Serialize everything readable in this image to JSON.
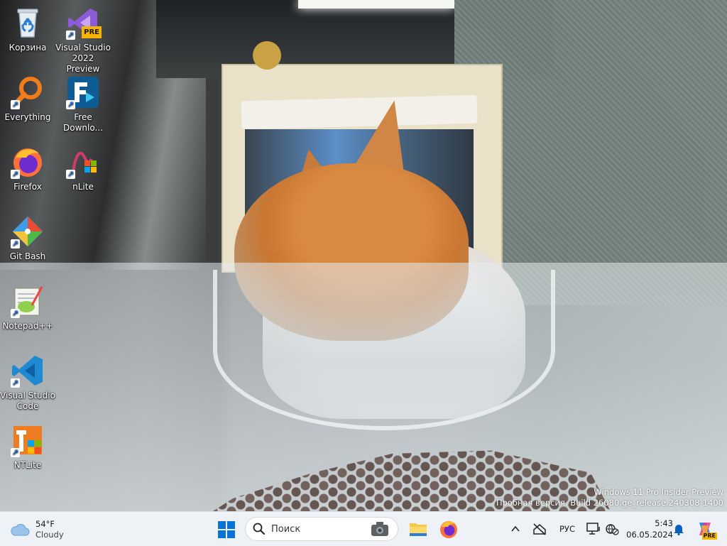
{
  "desktop": {
    "icons": [
      {
        "label": "Корзина"
      },
      {
        "label": "Visual Studio 2022 Preview",
        "badge": "PRE"
      },
      {
        "label": "Everything"
      },
      {
        "label": "Free Downlo..."
      },
      {
        "label": "Firefox"
      },
      {
        "label": "nLite"
      },
      {
        "label": "Git Bash"
      },
      {
        "label": "Notepad++"
      },
      {
        "label": "Visual Studio Code"
      },
      {
        "label": "NTLite"
      }
    ]
  },
  "watermark": {
    "line1": "Windows 11 Pro Insider Preview",
    "line2": "Пробная версия. Build 26080.ge_release.240308-1400"
  },
  "taskbar": {
    "weather": {
      "temp": "54°F",
      "condition": "Cloudy"
    },
    "search": {
      "placeholder": "Поиск"
    },
    "tray": {
      "language": "РУС",
      "time": "5:43",
      "date": "06.05.2024",
      "copilot_badge": "PRE"
    }
  },
  "colors": {
    "taskbar_bg": "#eef1f6",
    "windows_blue": "#0a74d6",
    "vscode_blue": "#1f8ad2",
    "firefox_orange": "#ff7139"
  }
}
